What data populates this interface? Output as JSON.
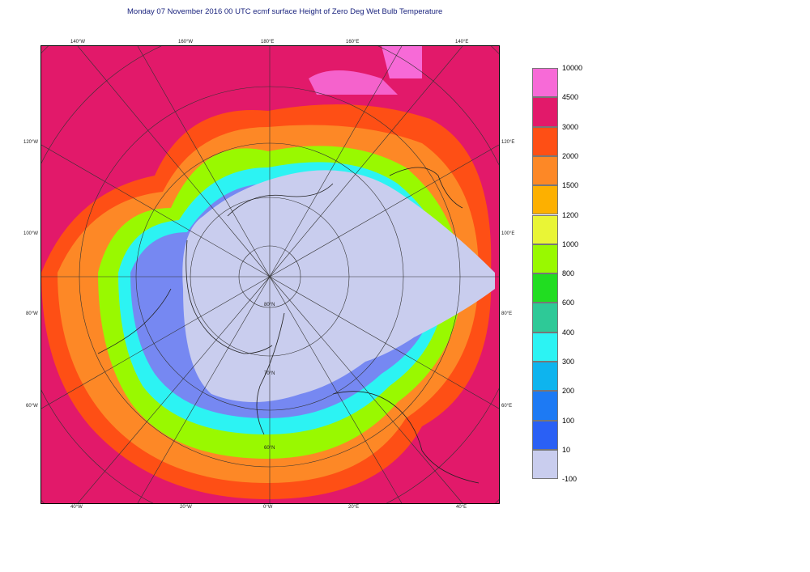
{
  "title": "Monday 07 November 2016 00 UTC ecmf surface  Height of Zero Deg Wet Bulb Temperature",
  "labels": {
    "top": [
      "140°W",
      "160°W",
      "180°E",
      "160°E",
      "140°E"
    ],
    "bottom": [
      "40°W",
      "20°W",
      "0°W",
      "20°E",
      "40°E"
    ],
    "left": [
      "120°W",
      "100°W",
      "80°W",
      "60°W"
    ],
    "right": [
      "120°E",
      "100°E",
      "80°E",
      "60°E"
    ],
    "lat": [
      "80°N",
      "70°N",
      "60°N"
    ]
  },
  "legend": {
    "values": [
      "10000",
      "4500",
      "3000",
      "2000",
      "1500",
      "1200",
      "1000",
      "800",
      "600",
      "400",
      "300",
      "200",
      "100",
      "10",
      "-100"
    ],
    "colors": [
      "#f76ad7",
      "#e2196a",
      "#fe4f15",
      "#fd8826",
      "#fdb000",
      "#e9f536",
      "#99f900",
      "#21dd21",
      "#2ec997",
      "#2cf3f3",
      "#0eb4ee",
      "#1d7af4",
      "#2a60f5",
      "#7688f2",
      "#c9cdee"
    ]
  }
}
